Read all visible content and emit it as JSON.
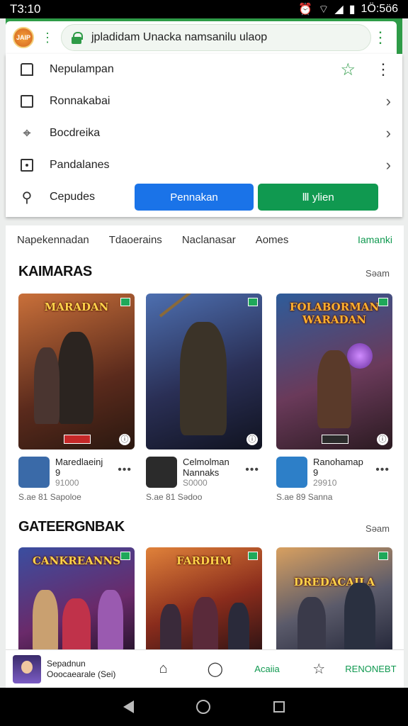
{
  "status": {
    "time": "T3:10",
    "right": "1Ö:5ö6"
  },
  "urlbar": {
    "badge": "JAIP",
    "url": "jpladidam Unacka namsanilu ulaop"
  },
  "menu": {
    "items": [
      {
        "label": "Nepulampan",
        "icon": "bookmark-icon"
      },
      {
        "label": "Ronnakabai",
        "icon": "file-icon"
      },
      {
        "label": "Bocdreika",
        "icon": "tag-icon"
      },
      {
        "label": "Pandalanes",
        "icon": "square-icon"
      },
      {
        "label": "Cepudes",
        "icon": "search-icon"
      }
    ],
    "btn_primary": "Pennakan",
    "btn_secondary": "Ⅲ ylien"
  },
  "tabs": [
    "Napekennadan",
    "Tdaoerains",
    "Naclanasar",
    "Aomes",
    "Iamanki"
  ],
  "sections": [
    {
      "title": "KAIMARAS",
      "more": "Səam",
      "cards": [
        {
          "cover_title": "MARADAN",
          "name": "Maredlaeinj",
          "sub": "9",
          "price": "91000",
          "rating": "S.ae 81   Sapoloe",
          "thumb": "#3a6aa8"
        },
        {
          "cover_title": "",
          "name": "Celmolman",
          "sub": "Nannaks",
          "price": "S0000",
          "rating": "S.ae 81   Sədoo",
          "thumb": "#2b2b2b"
        },
        {
          "cover_title": "FOLABORMAN WARADAN",
          "name": "Ranohamap",
          "sub": "9",
          "price": "29910",
          "rating": "S.ae 89   Sanna",
          "thumb": "#2d7fc8"
        }
      ]
    },
    {
      "title": "GATEERGNBAK",
      "more": "Səam",
      "cards": [
        {
          "cover_title": "CANKREANNS",
          "thumb": "#3a2b6b"
        },
        {
          "cover_title": "FARDHM",
          "thumb": "#b8411c"
        },
        {
          "cover_title": "DREDACAILA",
          "thumb": "#3c4a63"
        }
      ]
    }
  ],
  "bottombar": {
    "title": "Sepadnun",
    "sub": "Ooocaearale  (Sei)",
    "label_green": "Acaiia",
    "label_right": "RENONEBT"
  }
}
